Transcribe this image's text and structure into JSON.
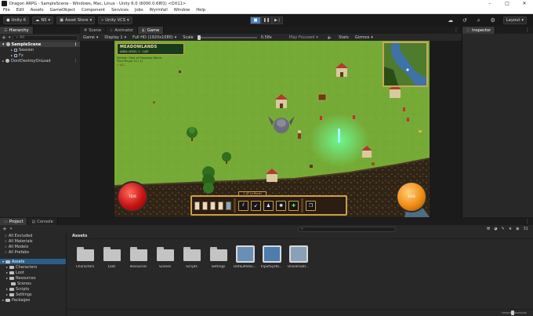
{
  "window": {
    "title": "Dragon ARPG - SampleScene - Windows, Mac, Linux - Unity 6.0 (6000.0.68f1) <DX11>",
    "minimize": "–",
    "maximize": "□",
    "close": "✕"
  },
  "menu": [
    "File",
    "Edit",
    "Assets",
    "GameObject",
    "Component",
    "Services",
    "Jobs",
    "Wyrmfall",
    "Window",
    "Help"
  ],
  "toolbar": {
    "account": "Unity 6",
    "ns": "NS",
    "asset_store": "Asset Store",
    "vcs": "Unity VCS",
    "layout": "Layout"
  },
  "hierarchy": {
    "tab": "Hierarchy",
    "search_placeholder": "All",
    "rows": [
      "SampleScene",
      "Session",
      "Fx",
      "DontDestroyOnLoad"
    ]
  },
  "center_tabs": [
    "Scene",
    "Animator",
    "Game"
  ],
  "game_bar": {
    "mode": "Game",
    "display": "Display 1",
    "resolution": "Full HD (1920x1080)",
    "scale_label": "Scale",
    "scale_value": "0.58x",
    "play_focused": "Play Focused",
    "stats": "Stats",
    "gizmos": "Gizmos"
  },
  "game": {
    "region": "MEADOWLANDS",
    "area": "AREA LEVEL 1 · 1/6F",
    "quest_1": "Defeat: Seal of Meadow Warm",
    "quest_2": "Find Mayor (0 / 1)",
    "quest_3": "• Kill...",
    "hp_text": "70/6",
    "mp_text": "10/6",
    "bar_label": "C AT Lo Runel"
  },
  "inspector": {
    "tab": "Inspector"
  },
  "project": {
    "tabs": [
      "Project",
      "Console"
    ],
    "count": "31",
    "searches": [
      "All Excluded",
      "All Materials",
      "All Models",
      "All Prefabs"
    ],
    "tree": [
      "Assets",
      "Characters",
      "Loot",
      "Resources",
      "Scenes",
      "Scripts",
      "Settings",
      "Packages"
    ],
    "breadcrumb": "Assets",
    "assets": [
      {
        "name": "Characters",
        "kind": "folder"
      },
      {
        "name": "Loot",
        "kind": "folder"
      },
      {
        "name": "Resources",
        "kind": "folder"
      },
      {
        "name": "Scenes",
        "kind": "folder"
      },
      {
        "name": "Scripts",
        "kind": "folder"
      },
      {
        "name": "Settings",
        "kind": "folder"
      },
      {
        "name": "DefaultVolu...",
        "kind": "package"
      },
      {
        "name": "InputSyste...",
        "kind": "package"
      },
      {
        "name": "UniversalR...",
        "kind": "package"
      }
    ]
  }
}
